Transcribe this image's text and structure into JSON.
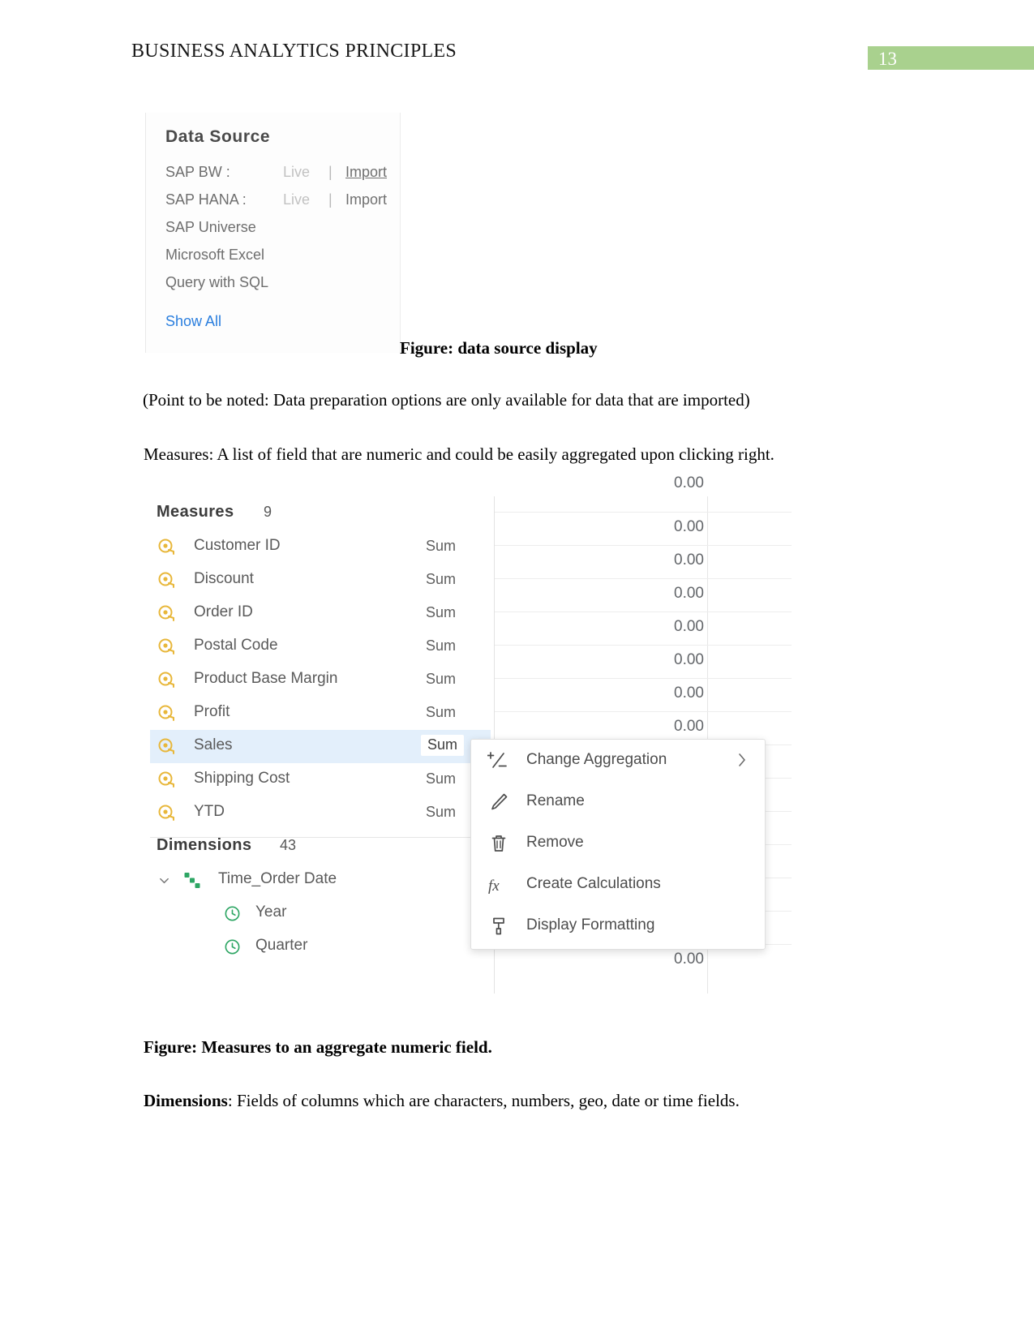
{
  "header": {
    "title": "BUSINESS ANALYTICS PRINCIPLES",
    "page_number": "13",
    "badge_color": "#a9d18e"
  },
  "figure_data_source": {
    "panel_title": "Data Source",
    "rows": [
      {
        "label": "SAP BW :",
        "live": "Live",
        "separator": "|",
        "import": "Import",
        "import_underlined": true
      },
      {
        "label": "SAP HANA :",
        "live": "Live",
        "separator": "|",
        "import": "Import",
        "import_underlined": false
      },
      {
        "label": "SAP Universe",
        "live": "",
        "separator": "",
        "import": ""
      },
      {
        "label": "Microsoft Excel",
        "live": "",
        "separator": "",
        "import": ""
      },
      {
        "label": "Query with SQL",
        "live": "",
        "separator": "",
        "import": ""
      }
    ],
    "show_all": "Show All",
    "show_all_color": "#2a7ede",
    "caption": "Figure: data source display"
  },
  "paragraphs": {
    "note": "(Point to be noted: Data preparation options are only available for data that are imported)",
    "measures_intro": "Measures: A list of field that are numeric and could be easily aggregated upon clicking right.",
    "dimensions_intro_bold": "Dimensions",
    "dimensions_intro_rest": ": Fields of columns which are characters, numbers, geo, date or time fields."
  },
  "figure_measures": {
    "caption": "Figure: Measures to an aggregate numeric field.",
    "measures_section": {
      "title": "Measures",
      "count": "9",
      "icon": "measure-tape-icon",
      "icon_color": "#e8b73a",
      "fields": [
        {
          "name": "Customer ID",
          "aggregation": "Sum",
          "selected": false
        },
        {
          "name": "Discount",
          "aggregation": "Sum",
          "selected": false
        },
        {
          "name": "Order ID",
          "aggregation": "Sum",
          "selected": false
        },
        {
          "name": "Postal Code",
          "aggregation": "Sum",
          "selected": false
        },
        {
          "name": "Product Base Margin",
          "aggregation": "Sum",
          "selected": false
        },
        {
          "name": "Profit",
          "aggregation": "Sum",
          "selected": false
        },
        {
          "name": "Sales",
          "aggregation": "Sum",
          "selected": true
        },
        {
          "name": "Shipping Cost",
          "aggregation": "Sum",
          "selected": false
        },
        {
          "name": "YTD",
          "aggregation": "Sum",
          "selected": false
        }
      ],
      "selected_row_color": "#e3effb"
    },
    "dimensions_section": {
      "title": "Dimensions",
      "count": "43",
      "hierarchy": {
        "name": "Time_Order Date",
        "icon": "hierarchy-icon",
        "icon_color": "#2ea664",
        "chevron": "chevron-down-icon",
        "children": [
          {
            "name": "Year",
            "icon": "clock-icon"
          },
          {
            "name": "Quarter",
            "icon": "clock-icon"
          }
        ]
      }
    },
    "data_grid": {
      "values": [
        "0.00",
        "0.00",
        "0.00",
        "0.00",
        "0.00",
        "0.00",
        "0.00",
        "0.00",
        "0.00",
        "0.00",
        "0.00",
        "0.00",
        "0.00",
        "0.00",
        "0.00"
      ]
    },
    "context_menu": {
      "items": [
        {
          "label": "Change Aggregation",
          "icon": "plus-minus-icon",
          "has_submenu": true
        },
        {
          "label": "Rename",
          "icon": "pencil-icon",
          "has_submenu": false
        },
        {
          "label": "Remove",
          "icon": "trash-icon",
          "has_submenu": false
        },
        {
          "label": "Create Calculations",
          "icon": "fx-icon",
          "has_submenu": false
        },
        {
          "label": "Display Formatting",
          "icon": "format-paint-icon",
          "has_submenu": false
        }
      ]
    }
  }
}
